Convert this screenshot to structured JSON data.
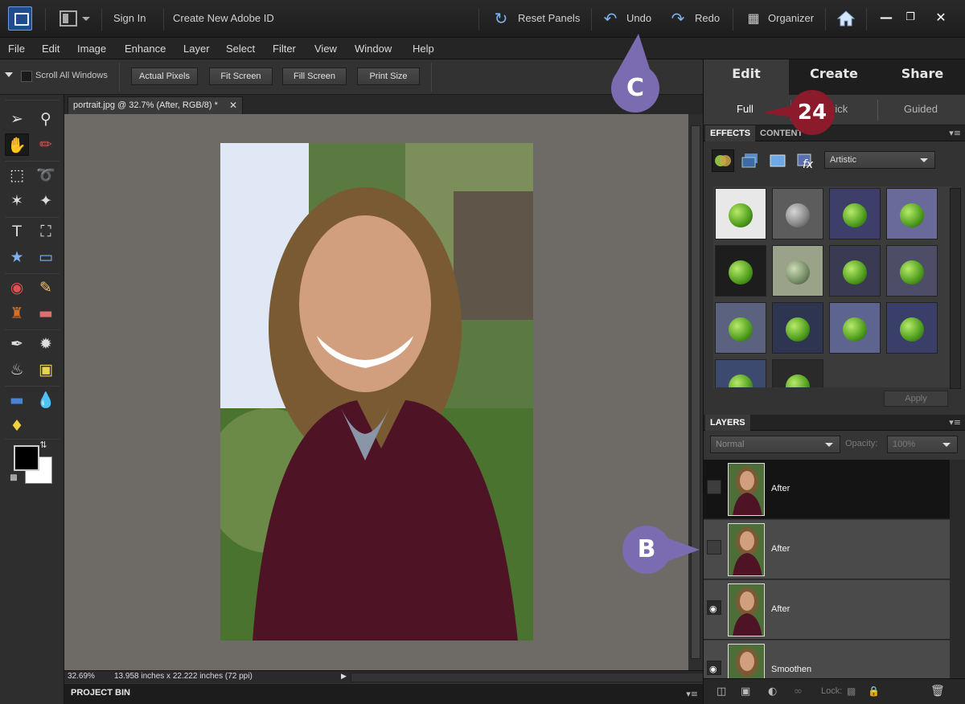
{
  "titlebar": {
    "sign_in": "Sign In",
    "create_id": "Create New Adobe ID",
    "reset_panels": "Reset Panels",
    "undo": "Undo",
    "redo": "Redo",
    "organizer": "Organizer"
  },
  "menu": [
    "File",
    "Edit",
    "Image",
    "Enhance",
    "Layer",
    "Select",
    "Filter",
    "View",
    "Window",
    "Help"
  ],
  "options": {
    "scroll_all": "Scroll All Windows",
    "actual_pixels": "Actual Pixels",
    "fit_screen": "Fit Screen",
    "fill_screen": "Fill Screen",
    "print_size": "Print Size"
  },
  "document": {
    "tab_title": "portrait.jpg @ 32.7% (After, RGB/8) *",
    "zoom": "32.69%",
    "doc_size": "13.958 inches x 22.222 inches (72 ppi)"
  },
  "project_bin": "PROJECT BIN",
  "right_panel": {
    "mode_tabs": [
      "Edit",
      "Create",
      "Share"
    ],
    "sub_tabs": [
      "Full",
      "Quick",
      "Guided"
    ],
    "effects_tab": "EFFECTS",
    "content_tab": "CONTENT",
    "effects_category": "Artistic",
    "apply": "Apply",
    "layers_title": "LAYERS",
    "blend_mode": "Normal",
    "opacity_label": "Opacity:",
    "opacity_value": "100%",
    "lock_label": "Lock:",
    "layers": [
      {
        "name": "After",
        "visible": false,
        "selected": true
      },
      {
        "name": "After",
        "visible": false,
        "selected": false
      },
      {
        "name": "After",
        "visible": true,
        "selected": false
      },
      {
        "name": "Smoothen",
        "visible": true,
        "selected": false
      }
    ]
  },
  "callouts": {
    "c": "C",
    "n24": "24",
    "b": "B"
  },
  "colors": {
    "callout_purple": "#7b6bb0",
    "callout_red": "#8b1a2a",
    "accent_blue": "#7db1ef"
  }
}
